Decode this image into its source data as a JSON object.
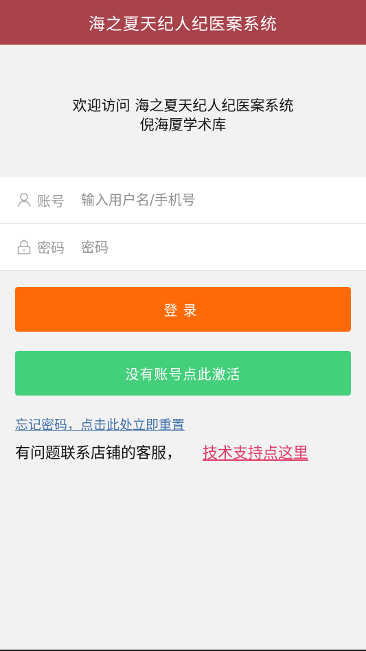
{
  "header": {
    "title": "海之夏天纪人纪医案系统"
  },
  "welcome": {
    "line1": "欢迎访问 海之夏天纪人纪医案系统",
    "line2": "倪海厦学术库"
  },
  "form": {
    "account": {
      "label": "账号",
      "placeholder": "输入用户名/手机号",
      "icon": "user-icon"
    },
    "password": {
      "label": "密码",
      "placeholder": "密码",
      "icon": "lock-icon"
    }
  },
  "buttons": {
    "login": "登录",
    "activate": "没有账号点此激活"
  },
  "links": {
    "forgot_password": "忘记密码，点击此处立即重置",
    "contact_prefix": "有问题联系店铺的客服，",
    "tech_support": "技术支持点这里"
  },
  "colors": {
    "header": "#a8424b",
    "login_button": "#ff6a08",
    "activate_button": "#44cf7b",
    "forgot_link": "#3f6fa8",
    "support_link": "#e23a66"
  }
}
